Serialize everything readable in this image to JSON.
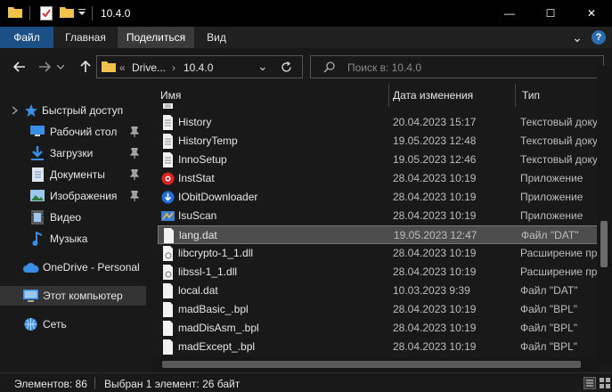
{
  "window": {
    "title": "10.4.0",
    "minimize_glyph": "—",
    "maximize_glyph": "☐",
    "close_glyph": "✕"
  },
  "ribbon": {
    "tabs": [
      {
        "label": "Файл"
      },
      {
        "label": "Главная"
      },
      {
        "label": "Поделиться"
      },
      {
        "label": "Вид"
      }
    ],
    "expand_glyph": "⌄",
    "help_glyph": "?"
  },
  "address": {
    "chevrons": "«",
    "crumb1": "Drive...",
    "crumb_sep": "›",
    "crumb2": "10.4.0",
    "dropdown_glyph": "⌄",
    "search_placeholder": "Поиск в: 10.4.0"
  },
  "navpane": {
    "items": [
      {
        "label": "Быстрый доступ",
        "icon": "star-icon"
      },
      {
        "label": "Рабочий стол",
        "icon": "desktop-icon",
        "pinned": true
      },
      {
        "label": "Загрузки",
        "icon": "download-icon",
        "pinned": true
      },
      {
        "label": "Документы",
        "icon": "documents-icon",
        "pinned": true
      },
      {
        "label": "Изображения",
        "icon": "pictures-icon",
        "pinned": true
      },
      {
        "label": "Видео",
        "icon": "video-icon"
      },
      {
        "label": "Музыка",
        "icon": "music-icon"
      },
      {
        "label": "OneDrive - Personal",
        "icon": "onedrive-icon"
      },
      {
        "label": "Этот компьютер",
        "icon": "computer-icon"
      },
      {
        "label": "Сеть",
        "icon": "network-icon"
      }
    ]
  },
  "columns": {
    "name": "Имя",
    "date": "Дата изменения",
    "type": "Тип"
  },
  "files": [
    {
      "name": "History",
      "date": "20.04.2023 15:17",
      "type": "Текстовый доку",
      "icon": "text-file-icon"
    },
    {
      "name": "HistoryTemp",
      "date": "19.05.2023 12:48",
      "type": "Текстовый доку",
      "icon": "text-file-icon"
    },
    {
      "name": "InnoSetup",
      "date": "19.05.2023 12:46",
      "type": "Текстовый доку",
      "icon": "text-file-icon"
    },
    {
      "name": "InstStat",
      "date": "28.04.2023 10:19",
      "type": "Приложение",
      "icon": "inststat-app-icon"
    },
    {
      "name": "IObitDownloader",
      "date": "28.04.2023 10:19",
      "type": "Приложение",
      "icon": "iobit-app-icon"
    },
    {
      "name": "IsuScan",
      "date": "28.04.2023 10:19",
      "type": "Приложение",
      "icon": "isuscan-app-icon"
    },
    {
      "name": "lang.dat",
      "date": "19.05.2023 12:47",
      "type": "Файл \"DAT\"",
      "icon": "file-icon",
      "selected": true
    },
    {
      "name": "libcrypto-1_1.dll",
      "date": "28.04.2023 10:19",
      "type": "Расширение пр",
      "icon": "dll-file-icon"
    },
    {
      "name": "libssl-1_1.dll",
      "date": "28.04.2023 10:19",
      "type": "Расширение пр",
      "icon": "dll-file-icon"
    },
    {
      "name": "local.dat",
      "date": "10.03.2023 9:39",
      "type": "Файл \"DAT\"",
      "icon": "file-icon"
    },
    {
      "name": "madBasic_.bpl",
      "date": "28.04.2023 10:19",
      "type": "Файл \"BPL\"",
      "icon": "file-icon"
    },
    {
      "name": "madDisAsm_.bpl",
      "date": "28.04.2023 10:19",
      "type": "Файл \"BPL\"",
      "icon": "file-icon"
    },
    {
      "name": "madExcept_.bpl",
      "date": "28.04.2023 10:19",
      "type": "Файл \"BPL\"",
      "icon": "file-icon"
    }
  ],
  "status": {
    "count": "Элементов: 86",
    "selection": "Выбран 1 элемент: 26 байт"
  },
  "colors": {
    "file_tab": "#1c4f86",
    "folder_yellow": "#f0c24b",
    "accent_blue": "#3a8ee6"
  }
}
